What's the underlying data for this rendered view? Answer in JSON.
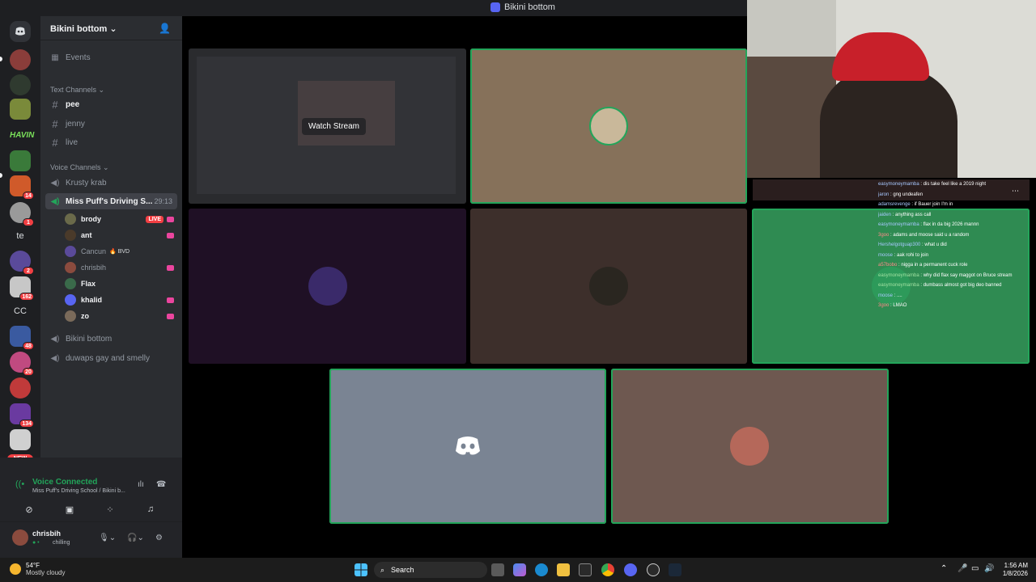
{
  "window": {
    "title": "Bikini bottom"
  },
  "server_rail": {
    "items": [
      {
        "name": "discord-home",
        "color": "#313338"
      },
      {
        "name": "server-1",
        "color": "#8a3d3a"
      },
      {
        "name": "server-2",
        "color": "#2f3a2f"
      },
      {
        "name": "server-3",
        "color": "#7a8a3a"
      },
      {
        "name": "server-havin",
        "text": "HAVIN",
        "color": "#1e1f22"
      },
      {
        "name": "server-5",
        "color": "#3a7a3a"
      },
      {
        "name": "server-6",
        "color": "#d05a2a",
        "badge": "14"
      },
      {
        "name": "server-7",
        "color": "#9a9a9a",
        "badge": "1"
      },
      {
        "name": "server-te",
        "text": "te"
      },
      {
        "name": "server-9",
        "color": "#5a4a9a",
        "badge": "2"
      },
      {
        "name": "server-10",
        "color": "#c7c7c7",
        "badge": "162"
      },
      {
        "name": "server-cc",
        "text": "CC"
      },
      {
        "name": "server-12",
        "color": "#3a5aa0",
        "badge": "48"
      },
      {
        "name": "server-13",
        "color": "#c04a80",
        "badge": "20"
      },
      {
        "name": "server-14",
        "color": "#c03a3a"
      },
      {
        "name": "server-15",
        "color": "#6a3aa0",
        "badge": "134"
      },
      {
        "name": "server-16",
        "color": "#d0d0d0"
      }
    ],
    "new_label": "NEW"
  },
  "sidebar": {
    "server_name": "Bikini bottom",
    "events_label": "Events",
    "text_category": "Text Channels",
    "text_channels": [
      "pee",
      "jenny",
      "live"
    ],
    "voice_category": "Voice Channels",
    "voice_channels": {
      "krusty": "Krusty krab",
      "active": "Miss Puff's Driving S...",
      "active_timer": "29:13",
      "bikini": "Bikini bottom",
      "duwaps": "duwaps gay and smelly"
    },
    "users": [
      {
        "name": "brody",
        "live": "LIVE"
      },
      {
        "name": "ant"
      },
      {
        "name": "Cancun",
        "tag": "BVD"
      },
      {
        "name": "chrisbih"
      },
      {
        "name": "Flax"
      },
      {
        "name": "khalid"
      },
      {
        "name": "zo"
      }
    ]
  },
  "voice_panel": {
    "status": "Voice Connected",
    "channel": "Miss Puff's Driving School / Bikini b..."
  },
  "user_bar": {
    "username": "chrisbih",
    "status": "chilling"
  },
  "stage": {
    "watch_stream_label": "Watch Stream"
  },
  "chat": {
    "lines": [
      {
        "user": "easymoneymamba",
        "text": "dis take feel like a 2019 night"
      },
      {
        "user": "jaron",
        "text": "gng undeafen"
      },
      {
        "user": "adamsrevenge",
        "text": "if Bauer join I'm in"
      },
      {
        "user": "jaiden",
        "text": "anything ass call"
      },
      {
        "user": "easymoneymamba",
        "text": "flax in da big 2026 mannn"
      },
      {
        "user": "3goo",
        "text": "adams and moose said u a random"
      },
      {
        "user": "Hershelgotguap300",
        "text": "what u did"
      },
      {
        "user": "moose",
        "text": "aak rohi to join"
      },
      {
        "user": "a57bobo",
        "text": "nigga in a permanent cuck role"
      },
      {
        "user": "easymoneymamba",
        "text": "why did flax say maggot on Bruce stream"
      },
      {
        "user": "easymoneymamba",
        "text": "dumbass almost got big deo banned"
      },
      {
        "user": "moose",
        "text": "...."
      },
      {
        "user": "3goo",
        "text": "LMAO"
      }
    ]
  },
  "taskbar": {
    "temperature": "54°F",
    "condition": "Mostly cloudy",
    "search_label": "Search",
    "time": "1:56 AM",
    "date": "1/8/2026"
  }
}
